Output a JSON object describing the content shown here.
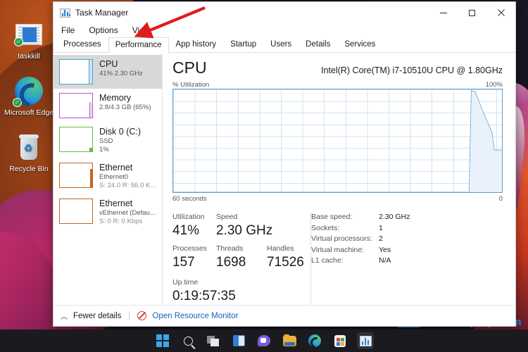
{
  "desktop": {
    "icons": [
      {
        "name": "taskkill",
        "icon": "document-icon"
      },
      {
        "name": "Microsoft Edge",
        "icon": "edge-icon"
      },
      {
        "name": "Recycle Bin",
        "icon": "recycle-bin-icon"
      }
    ]
  },
  "taskbar": {
    "items": [
      {
        "label": "Start",
        "icon": "windows-start-icon"
      },
      {
        "label": "Search",
        "icon": "search-icon"
      },
      {
        "label": "Task View",
        "icon": "task-view-icon"
      },
      {
        "label": "Widgets",
        "icon": "widgets-icon"
      },
      {
        "label": "Chat",
        "icon": "chat-icon"
      },
      {
        "label": "File Explorer",
        "icon": "folder-icon"
      },
      {
        "label": "Microsoft Edge",
        "icon": "edge-icon"
      },
      {
        "label": "Microsoft Store",
        "icon": "store-icon"
      },
      {
        "label": "Task Manager",
        "icon": "task-manager-icon"
      }
    ]
  },
  "watermark": {
    "cn": "爱纯净",
    "en": "aichunjing.com",
    "accent": "#2196f3"
  },
  "window": {
    "title": "Task Manager",
    "controls": {
      "minimize": "–",
      "maximize": "□",
      "close": "✕"
    },
    "menu": [
      "File",
      "Options",
      "View"
    ],
    "tabs": [
      {
        "label": "Processes",
        "active": false
      },
      {
        "label": "Performance",
        "active": true
      },
      {
        "label": "App history",
        "active": false
      },
      {
        "label": "Startup",
        "active": false
      },
      {
        "label": "Users",
        "active": false
      },
      {
        "label": "Details",
        "active": false
      },
      {
        "label": "Services",
        "active": false
      }
    ]
  },
  "sidebar": {
    "items": [
      {
        "title": "CPU",
        "sub1": "41% 2.30 GHz",
        "sub2": "",
        "color": "#4a9fd8",
        "selected": true
      },
      {
        "title": "Memory",
        "sub1": "2.8/4.3 GB (65%)",
        "sub2": "",
        "color": "#bb55cc",
        "selected": false
      },
      {
        "title": "Disk 0 (C:)",
        "sub1": "SSD",
        "sub2": "1%",
        "color": "#6cbb3c",
        "selected": false
      },
      {
        "title": "Ethernet",
        "sub1": "Ethernet0",
        "sub2": "S: 24.0 R: 56.0 Kbps",
        "color": "#c8641a",
        "selected": false
      },
      {
        "title": "Ethernet",
        "sub1": "vEthernet (Default ...",
        "sub2": "S: 0 R: 0 Kbps",
        "color": "#c8641a",
        "selected": false
      }
    ]
  },
  "main": {
    "heading": "CPU",
    "model": "Intel(R) Core(TM) i7-10510U CPU @ 1.80GHz",
    "graph_label_left": "% Utilization",
    "graph_label_right": "100%",
    "axis_left": "60 seconds",
    "axis_right": "0",
    "stats": {
      "utilization": {
        "label": "Utilization",
        "value": "41%"
      },
      "speed": {
        "label": "Speed",
        "value": "2.30 GHz"
      },
      "processes": {
        "label": "Processes",
        "value": "157"
      },
      "threads": {
        "label": "Threads",
        "value": "1698"
      },
      "handles": {
        "label": "Handles",
        "value": "71526"
      },
      "uptime": {
        "label": "Up time",
        "value": "0:19:57:35"
      }
    },
    "details": [
      {
        "key": "Base speed:",
        "value": "2.30 GHz"
      },
      {
        "key": "Sockets:",
        "value": "1"
      },
      {
        "key": "Virtual processors:",
        "value": "2"
      },
      {
        "key": "Virtual machine:",
        "value": "Yes"
      },
      {
        "key": "L1 cache:",
        "value": "N/A"
      }
    ]
  },
  "footer": {
    "fewer_details": "Fewer details",
    "resource_monitor": "Open Resource Monitor"
  },
  "chart_data": {
    "type": "area",
    "title": "% Utilization",
    "xlabel": "60 seconds",
    "ylabel": "% Utilization",
    "ylim": [
      0,
      100
    ],
    "xlim": [
      0,
      60
    ],
    "grid": true,
    "series": [
      {
        "name": "CPU % Utilization",
        "x": [
          0,
          54.0,
          54.4,
          55.2,
          56.4,
          58.2,
          58.6,
          60
        ],
        "values": [
          0,
          0,
          99,
          97,
          80,
          58,
          41,
          41
        ]
      }
    ],
    "line_color": "#4a9fd8",
    "fill_color": "#e9f2fa"
  }
}
